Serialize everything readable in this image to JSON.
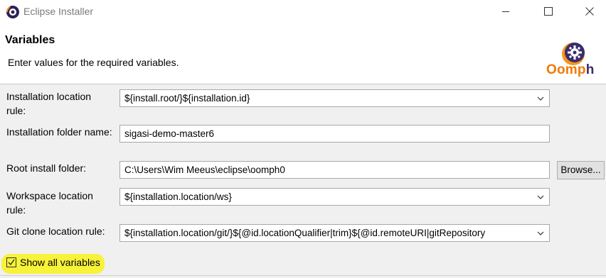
{
  "window": {
    "title": "Eclipse Installer"
  },
  "header": {
    "title": "Variables",
    "description": "Enter values for the required variables.",
    "logo_text_main": "Oomp",
    "logo_text_end": "h"
  },
  "fields": [
    {
      "label": "Installation location rule:",
      "type": "combo",
      "value": "${install.root/}${installation.id}"
    },
    {
      "label": "Installation folder name:",
      "type": "text",
      "value": "sigasi-demo-master6"
    },
    {
      "label": "Root install folder:",
      "type": "text",
      "value": "C:\\Users\\Wim Meeus\\eclipse\\oomph0"
    },
    {
      "label": "Workspace location rule:",
      "type": "combo",
      "value": "${installation.location/ws}"
    },
    {
      "label": "Git clone location rule:",
      "type": "combo",
      "value": "${installation.location/git/}${@id.locationQualifier|trim}${@id.remoteURI|gitRepository"
    }
  ],
  "browse_button": {
    "label": "Browse..."
  },
  "show_all_variables": {
    "label": "Show all variables",
    "checked": true
  },
  "colors": {
    "highlight": "#f7f23a",
    "logo_orange": "#f07a00",
    "logo_purple": "#3b2c6b"
  }
}
